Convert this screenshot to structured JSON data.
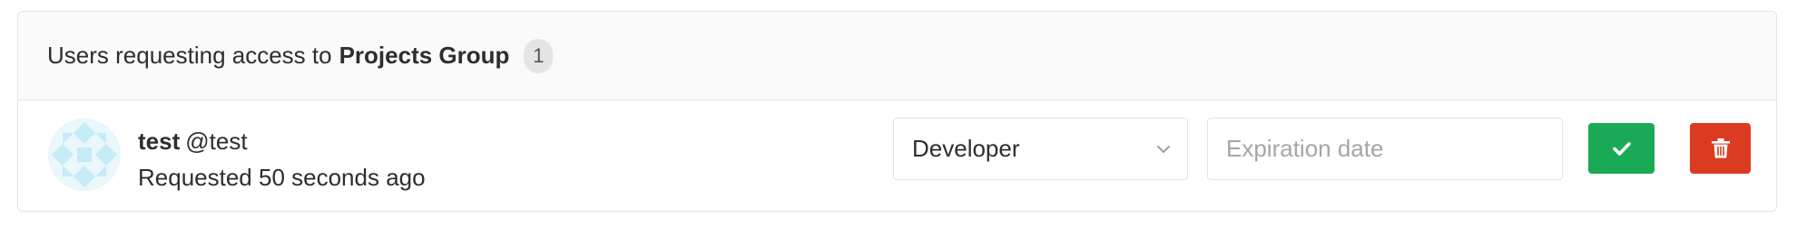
{
  "header": {
    "prefix": "Users requesting access to",
    "group_name": "Projects Group",
    "request_count": "1"
  },
  "member": {
    "name": "test",
    "handle": "@test",
    "requested": "Requested 50 seconds ago",
    "avatar_icon": "identicon-avatar"
  },
  "role_select": {
    "selected": "Developer",
    "icon": "chevron-down-icon"
  },
  "expiration": {
    "value": "",
    "placeholder": "Expiration date"
  },
  "actions": {
    "approve_icon": "check-icon",
    "deny_icon": "trash-icon"
  },
  "colors": {
    "approve": "#1aaa55",
    "deny": "#db3b21",
    "header_bg": "#fafafa",
    "border": "#e5e5e5",
    "avatar": "#c6ecf6"
  }
}
